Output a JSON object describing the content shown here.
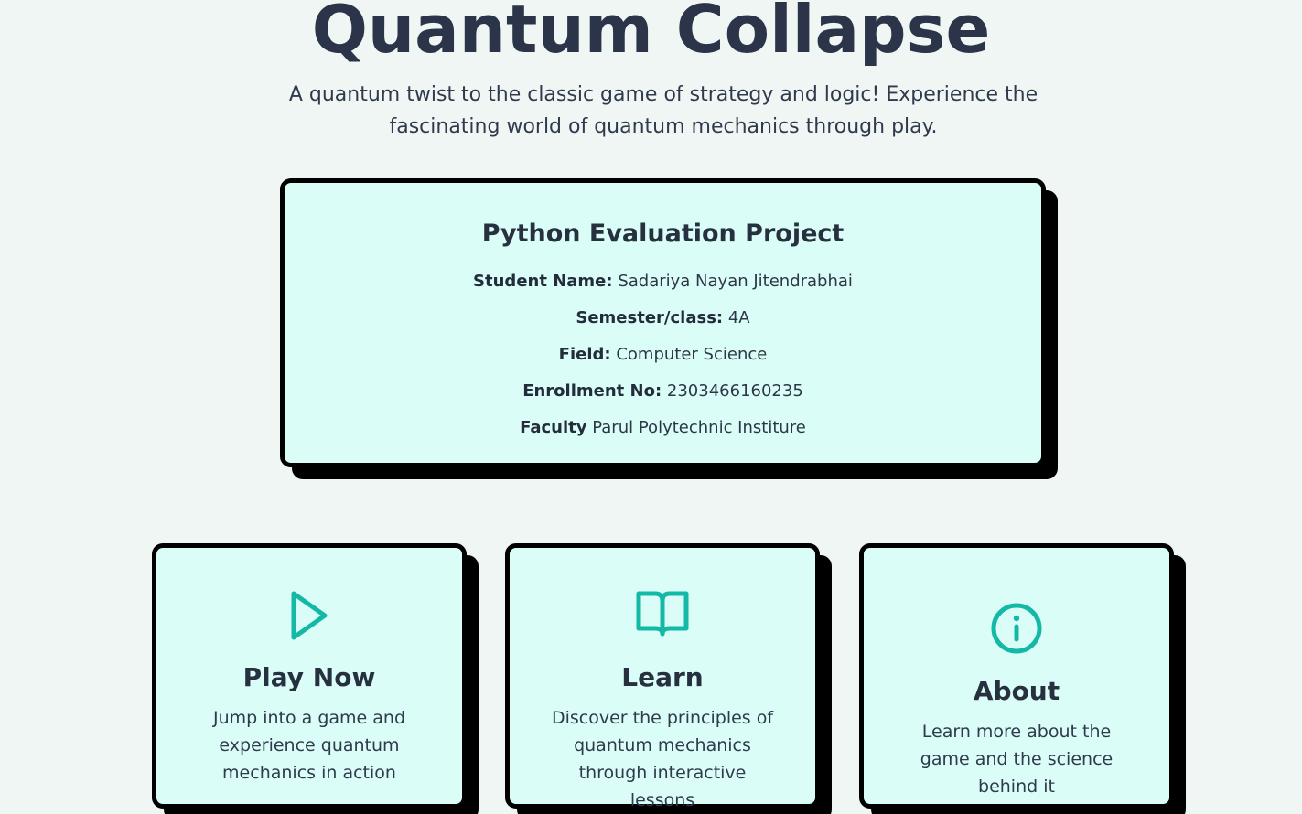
{
  "header": {
    "title": "Quantum Collapse",
    "subtitle": "A quantum twist to the classic game of strategy and logic! Experience the fascinating world of quantum mechanics through play."
  },
  "info_card": {
    "heading": "Python Evaluation Project",
    "rows": [
      {
        "label": "Student Name:",
        "value": "Sadariya Nayan Jitendrabhai"
      },
      {
        "label": "Semester/class:",
        "value": "4A"
      },
      {
        "label": "Field:",
        "value": "Computer Science"
      },
      {
        "label": "Enrollment No:",
        "value": "2303466160235"
      },
      {
        "label": "Faculty",
        "value": "Parul Polytechnic Institure"
      }
    ]
  },
  "cards": [
    {
      "icon": "play-icon",
      "title": "Play Now",
      "description": "Jump into a game and experience quantum mechanics in action"
    },
    {
      "icon": "book-icon",
      "title": "Learn",
      "description": "Discover the principles of quantum mechanics through interactive lessons"
    },
    {
      "icon": "info-icon",
      "title": "About",
      "description": "Learn more about the game and the science behind it"
    }
  ],
  "colors": {
    "background": "#f0f6f4",
    "card_background": "#dafef7",
    "accent": "#14b8a6",
    "text": "#2a3446",
    "shadow": "#000000"
  }
}
